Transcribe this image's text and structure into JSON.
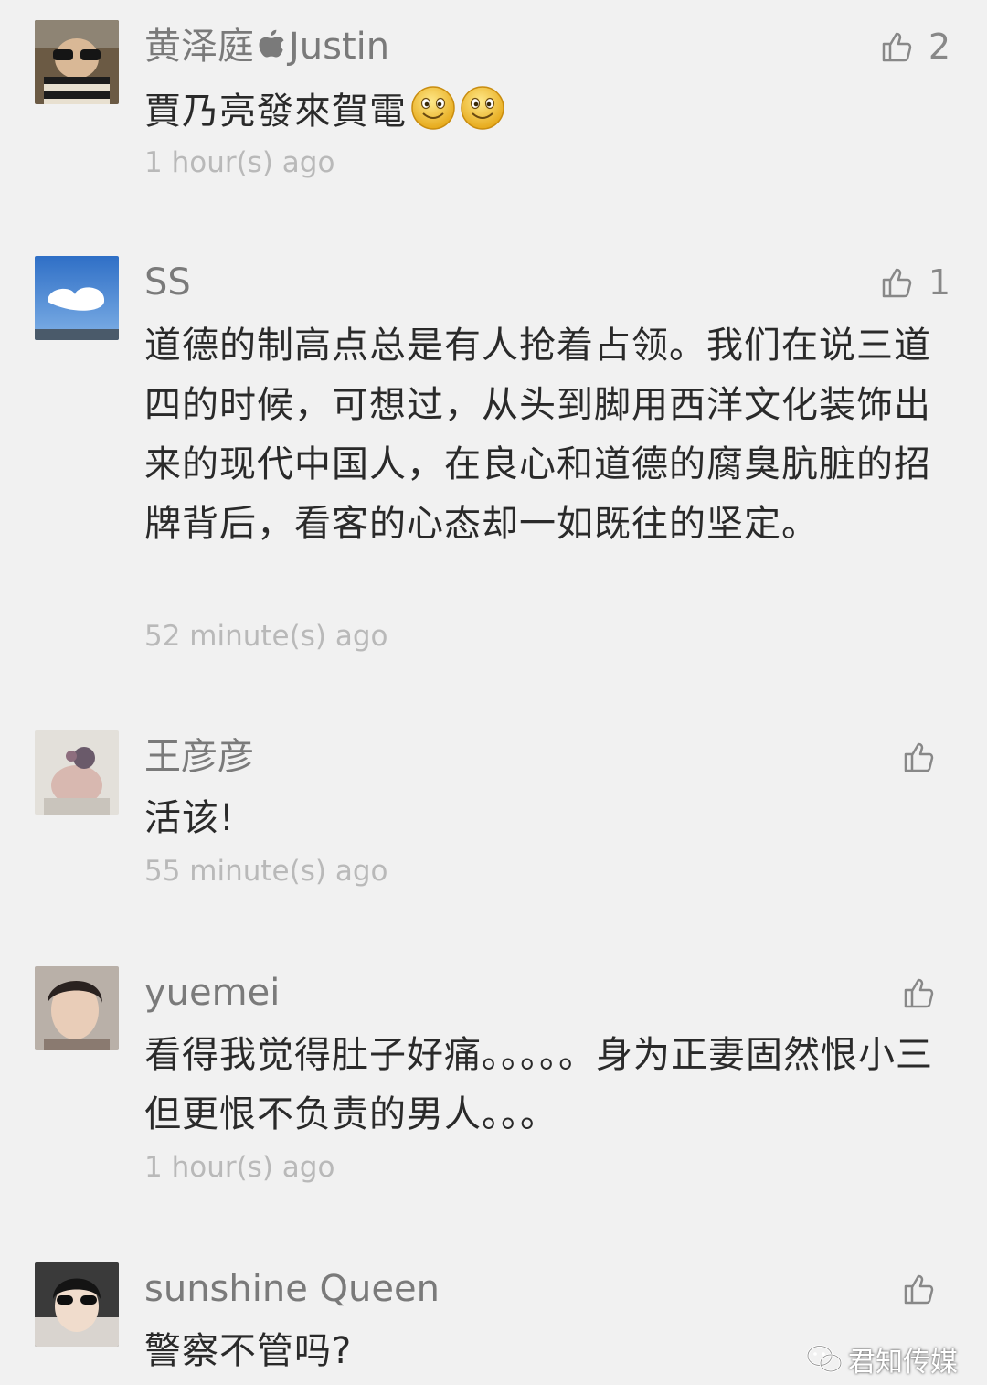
{
  "comments": [
    {
      "name": "黄泽庭",
      "name_suffix": "Justin",
      "likes": "2",
      "text": "賈乃亮發來賀電",
      "time": "1 hour(s) ago"
    },
    {
      "name": "SS",
      "likes": "1",
      "text": "道德的制高点总是有人抢着占领。我们在说三道四的时候，可想过，从头到脚用西洋文化装饰出来的现代中国人，在良心和道德的腐臭肮脏的招牌背后，看客的心态却一如既往的坚定。",
      "time": "52 minute(s) ago"
    },
    {
      "name": "王彦彦",
      "likes": "",
      "text": "活该!",
      "time": "55 minute(s) ago"
    },
    {
      "name": "yuemei",
      "likes": "",
      "text": "看得我觉得肚子好痛。。。。。身为正妻固然恨小三但更恨不负责的男人。。。",
      "time": "1 hour(s) ago"
    },
    {
      "name": "sunshine Queen",
      "likes": "",
      "text": "警察不管吗?",
      "time": ""
    }
  ],
  "watermark": {
    "text": "君知传媒",
    "icon": "wechat-icon"
  },
  "icons": {
    "like": "thumbs-up-icon",
    "brand": "apple-icon",
    "emoji": "smile-emoji-icon"
  },
  "colors": {
    "background": "#f1f1f1",
    "name": "#7a7a7a",
    "text": "#2a2a2a",
    "time": "#b9b9b9"
  }
}
